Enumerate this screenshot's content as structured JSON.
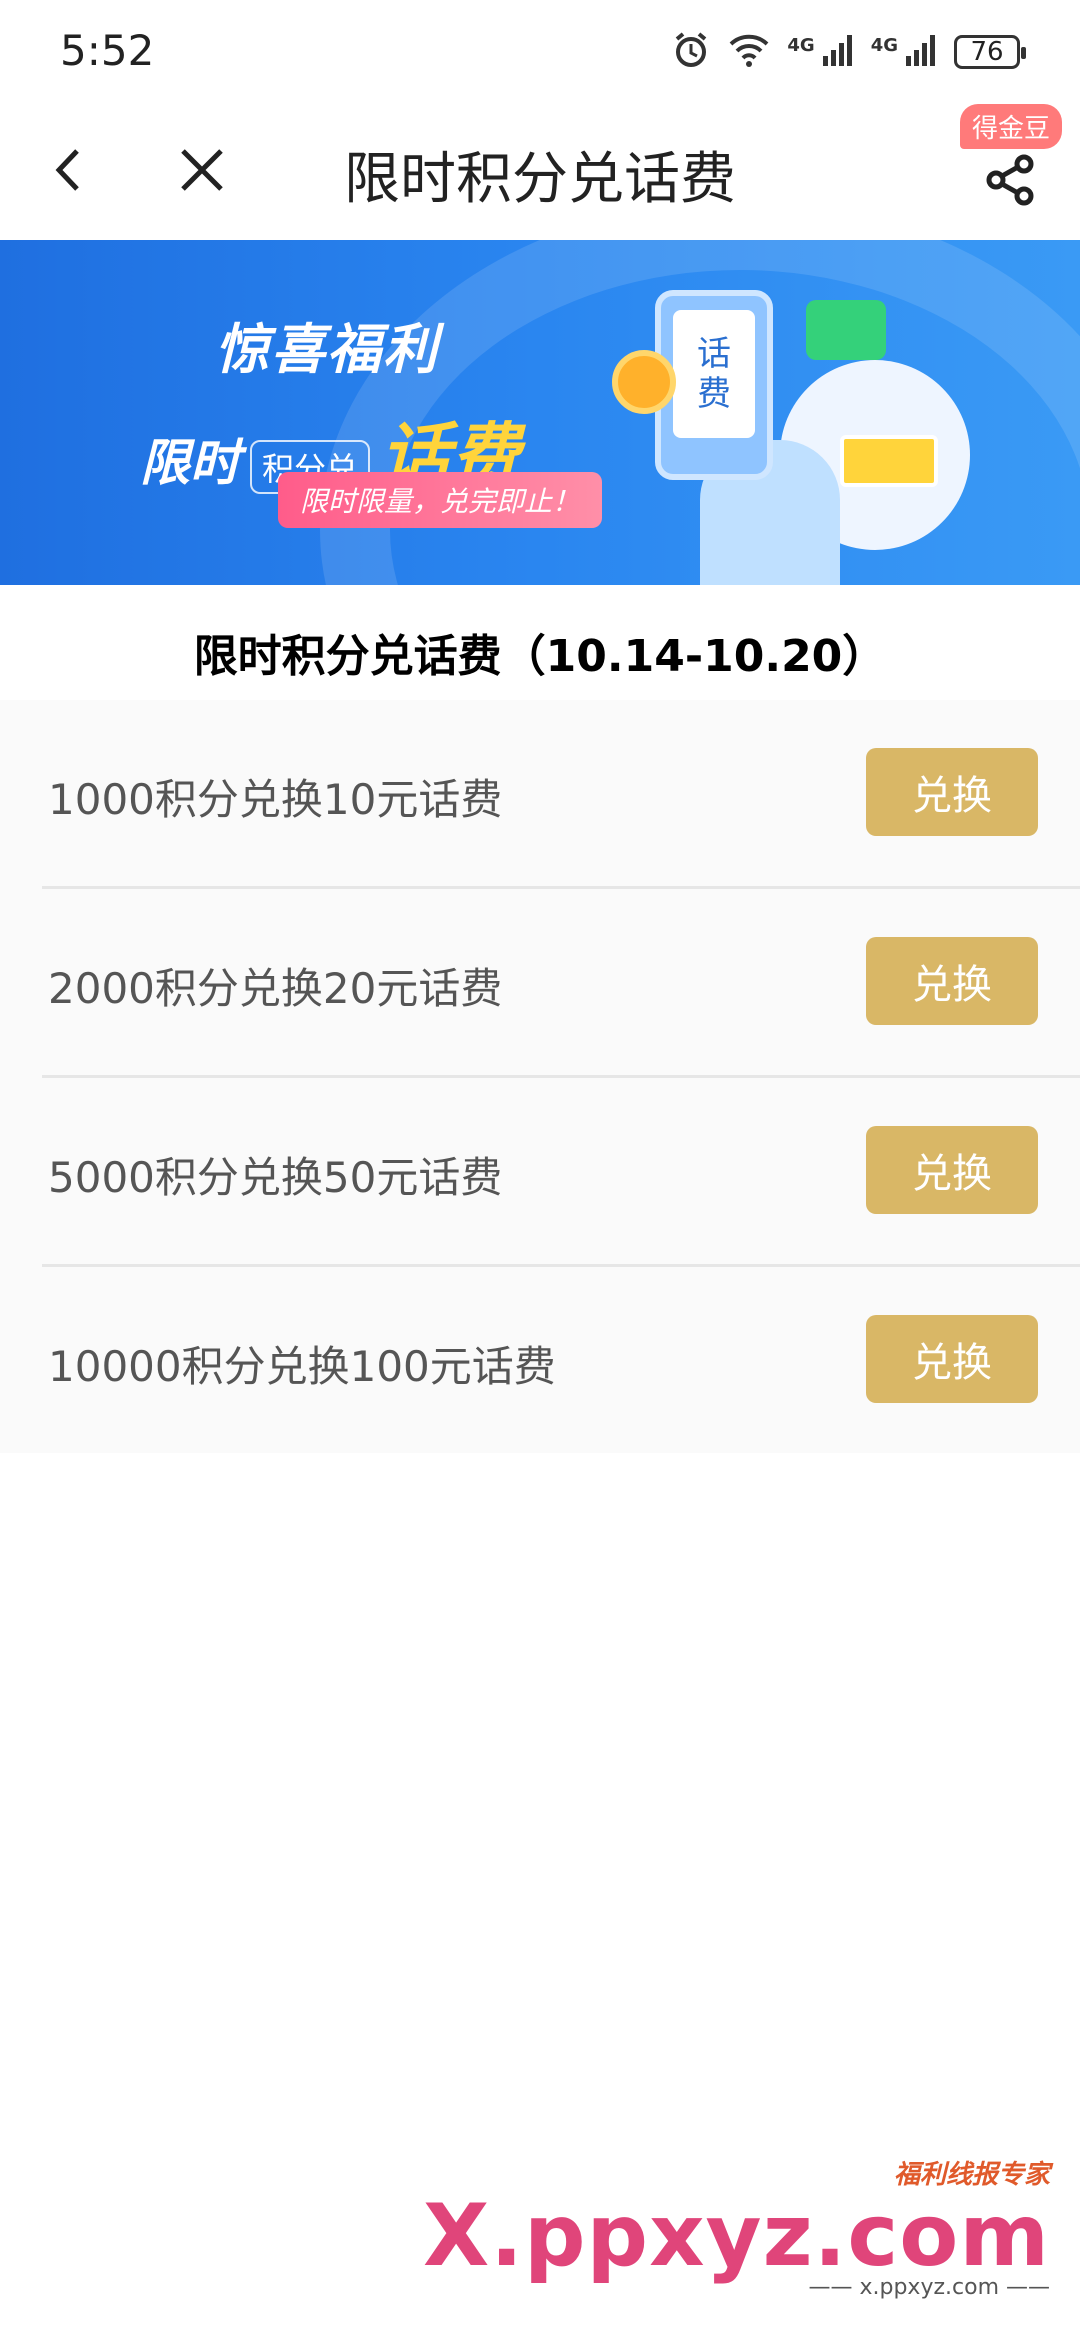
{
  "status_bar": {
    "time": "5:52",
    "network1": "4G",
    "network2": "4G",
    "battery": "76"
  },
  "nav": {
    "title": "限时积分兑话费",
    "badge": "得金豆"
  },
  "banner": {
    "line1": "惊喜福利",
    "line2_prefix": "限时",
    "line2_mid": "积分兑",
    "line2_main": "话费",
    "pill": "限时限量，兑完即止！",
    "phone_line1": "话",
    "phone_line2": "费"
  },
  "section_title": "限时积分兑话费（10.14-10.20）",
  "items": [
    {
      "label": "1000积分兑换10元话费",
      "button": "兑换"
    },
    {
      "label": "2000积分兑换20元话费",
      "button": "兑换"
    },
    {
      "label": "5000积分兑换50元话费",
      "button": "兑换"
    },
    {
      "label": "10000积分兑换100元话费",
      "button": "兑换"
    }
  ],
  "watermark": {
    "small": "福利线报专家",
    "big": "X.ppxyz.com",
    "sub": "—— x.ppxyz.com ——"
  },
  "colors": {
    "accent": "#d9b766",
    "banner": "#2a86f0",
    "badge": "#ff7a7a"
  }
}
